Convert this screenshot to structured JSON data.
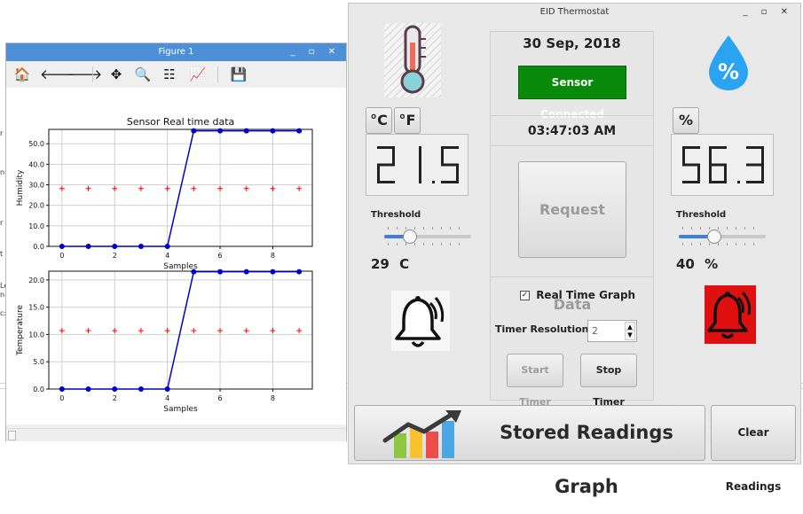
{
  "background": {
    "fragments": [
      "r",
      "nu",
      "r",
      "t",
      "Le",
      "n(",
      "c:"
    ]
  },
  "figure": {
    "title": "Figure 1",
    "window_buttons": "_ ▫ ✕",
    "toolbar": [
      {
        "name": "home-icon",
        "glyph": "🏠"
      },
      {
        "name": "back-arrow-icon",
        "glyph": "🡐"
      },
      {
        "name": "forward-arrow-icon",
        "glyph": "🡒"
      },
      {
        "name": "pan-icon",
        "glyph": "✥"
      },
      {
        "name": "zoom-icon",
        "glyph": "🔍"
      },
      {
        "name": "subplots-config-icon",
        "glyph": "☷"
      },
      {
        "name": "edit-axes-icon",
        "glyph": "📈"
      },
      {
        "name": "save-icon",
        "glyph": "💾"
      }
    ]
  },
  "chart_data": [
    {
      "type": "line",
      "title": "Sensor Real time data",
      "xlabel": "Samples",
      "ylabel": "Humidity",
      "x": [
        0,
        1,
        2,
        3,
        4,
        5,
        6,
        7,
        8,
        9
      ],
      "xlim": [
        -0.5,
        9.5
      ],
      "ylim": [
        0,
        57
      ],
      "xticks": [
        0,
        2,
        4,
        6,
        8
      ],
      "yticks": [
        0.0,
        10.0,
        20.0,
        30.0,
        40.0,
        50.0
      ],
      "grid": true,
      "series": [
        {
          "style": "line-dot",
          "color": "#0000cc",
          "values": [
            0,
            0,
            0,
            0,
            0,
            56.3,
            56.3,
            56.3,
            56.3,
            56.3
          ]
        },
        {
          "style": "plus",
          "color": "#ff0000",
          "values": [
            28.2,
            28.2,
            28.2,
            28.2,
            28.2,
            28.2,
            28.2,
            28.2,
            28.2,
            28.2
          ]
        }
      ]
    },
    {
      "type": "line",
      "title": "",
      "xlabel": "Samples",
      "ylabel": "Temperature",
      "x": [
        0,
        1,
        2,
        3,
        4,
        5,
        6,
        7,
        8,
        9
      ],
      "xlim": [
        -0.5,
        9.5
      ],
      "ylim": [
        0,
        21.6
      ],
      "xticks": [
        0,
        2,
        4,
        6,
        8
      ],
      "yticks": [
        0.0,
        5.0,
        10.0,
        15.0,
        20.0
      ],
      "grid": true,
      "series": [
        {
          "style": "line-dot",
          "color": "#0000cc",
          "values": [
            0,
            0,
            0,
            0,
            0,
            21.5,
            21.5,
            21.5,
            21.5,
            21.5
          ]
        },
        {
          "style": "plus",
          "color": "#ff0000",
          "values": [
            10.7,
            10.7,
            10.7,
            10.7,
            10.7,
            10.7,
            10.7,
            10.7,
            10.7,
            10.7
          ]
        }
      ]
    }
  ],
  "thermostat": {
    "title": "EID Thermostat",
    "window_buttons": "_ ▫ ✕",
    "date": "30 Sep, 2018",
    "sensor_status": "Sensor Connected",
    "time": "03:47:03 AM",
    "request_button": "Request Data",
    "realtime_checkbox_label": "Real Time Graph",
    "realtime_checked": true,
    "timer_label": "Timer Resolution",
    "timer_value": "2",
    "start_timer": "Start Timer",
    "stop_timer": "Stop Timer",
    "stored_graph_button": "Stored Readings Graph",
    "clear_button": "Clear Readings",
    "temperature": {
      "celsius_button": "°C",
      "fahrenheit_button": "°F",
      "reading": "21.5",
      "threshold_label": "Threshold",
      "threshold_value": "29",
      "unit": "C",
      "slider_fraction": 0.29
    },
    "humidity": {
      "percent_button": "%",
      "drop_label": "%",
      "reading": "56.3",
      "threshold_label": "Threshold",
      "threshold_value": "40",
      "unit": "%",
      "slider_fraction": 0.4
    },
    "colors": {
      "status_green": "#0a8a0a",
      "alarm_red": "#e01010",
      "drop_blue": "#2aa4f0"
    }
  }
}
